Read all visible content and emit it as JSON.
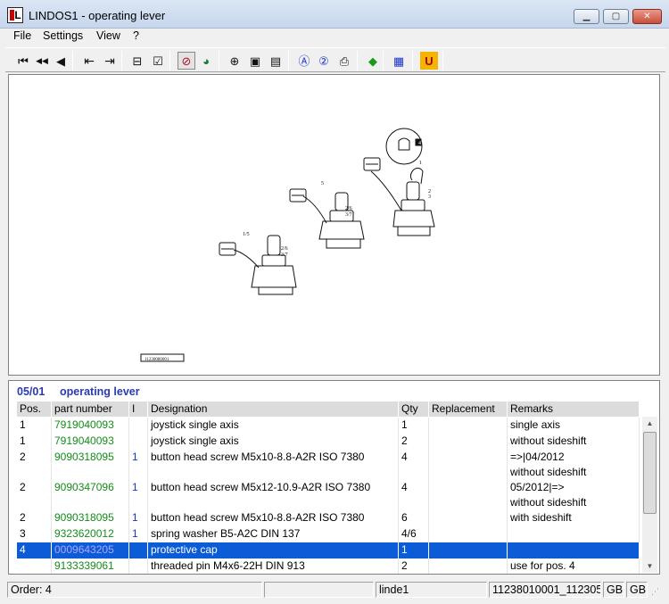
{
  "window": {
    "title": "LINDOS1 - operating lever",
    "app_icon_letter": "L"
  },
  "menu": [
    "File",
    "Settings",
    "View",
    "?"
  ],
  "toolbar": {
    "buttons": [
      {
        "icon": "first-icon",
        "glyph": "⏮"
      },
      {
        "icon": "fast-back-icon",
        "glyph": "◀◀"
      },
      {
        "icon": "back-icon",
        "glyph": "◀"
      },
      {
        "icon": "prev-page-icon",
        "glyph": "⇤"
      },
      {
        "icon": "next-page-icon",
        "glyph": "⇥"
      },
      {
        "icon": "cart-icon",
        "glyph": "⊟"
      },
      {
        "icon": "checklist-icon",
        "glyph": "☑"
      },
      {
        "icon": "hotspot-icon",
        "glyph": "⊘"
      },
      {
        "icon": "globe-icon",
        "glyph": "◕"
      },
      {
        "icon": "zoom-icon",
        "glyph": "⊕"
      },
      {
        "icon": "page-icon",
        "glyph": "▣"
      },
      {
        "icon": "page-alt-icon",
        "glyph": "▤"
      },
      {
        "icon": "search-a-icon",
        "glyph": "Ⓐ"
      },
      {
        "icon": "search-2-icon",
        "glyph": "②"
      },
      {
        "icon": "print-icon",
        "glyph": "⎙"
      },
      {
        "icon": "export-icon",
        "glyph": "◆"
      },
      {
        "icon": "grid-icon",
        "glyph": "▦"
      },
      {
        "icon": "u-icon",
        "glyph": "U"
      }
    ]
  },
  "section": {
    "code": "05/01",
    "name": "operating lever"
  },
  "table": {
    "headers": [
      "Pos.",
      "part number",
      "I",
      "Designation",
      "Qty",
      "Replacement",
      "Remarks"
    ],
    "rows": [
      {
        "pos": "1",
        "part_number": "7919040093",
        "ind": "",
        "designation": "joystick single axis",
        "qty": "1",
        "replacement": "",
        "remarks": "single axis",
        "remarks2": ""
      },
      {
        "pos": "1",
        "part_number": "7919040093",
        "ind": "",
        "designation": "joystick single axis",
        "qty": "2",
        "replacement": "",
        "remarks": "without sideshift",
        "remarks2": ""
      },
      {
        "pos": "2",
        "part_number": "9090318095",
        "ind": "1",
        "designation": "button head screw M5x10-8.8-A2R  ISO 7380",
        "qty": "4",
        "replacement": "",
        "remarks": "=>|04/2012",
        "remarks2": "without sideshift"
      },
      {
        "pos": "2",
        "part_number": "9090347096",
        "ind": "1",
        "designation": "button head screw M5x12-10.9-A2R  ISO 7380",
        "qty": "4",
        "replacement": "",
        "remarks": "05/2012|=>",
        "remarks2": "without sideshift"
      },
      {
        "pos": "2",
        "part_number": "9090318095",
        "ind": "1",
        "designation": "button head screw M5x10-8.8-A2R  ISO 7380",
        "qty": "6",
        "replacement": "",
        "remarks": "with sideshift",
        "remarks2": ""
      },
      {
        "pos": "3",
        "part_number": "9323620012",
        "ind": "1",
        "designation": "spring washer B5-A2C  DIN 137",
        "qty": "4/6",
        "replacement": "",
        "remarks": "",
        "remarks2": ""
      },
      {
        "pos": "4",
        "part_number": "0009643205",
        "ind": "",
        "designation": "protective cap",
        "qty": "1",
        "replacement": "",
        "remarks": "",
        "remarks2": "",
        "selected": true
      },
      {
        "pos": "",
        "part_number": "9133339061",
        "ind": "",
        "designation": "threaded pin M4x6-22H  DIN 913",
        "qty": "2",
        "replacement": "",
        "remarks": "use for pos. 4",
        "remarks2": ""
      }
    ]
  },
  "drawing": {
    "drawing_number": "11230080001",
    "labels": {
      "l1": "1",
      "l4": "4",
      "l5": "5",
      "l15": "1/5",
      "l26a": "2/6",
      "l37a": "3/7",
      "l26b": "2/6",
      "l37b": "3/7",
      "l2": "2",
      "l3": "3"
    }
  },
  "status": {
    "order": "Order: 4",
    "blank": "",
    "user": "linde1",
    "document": "11238010001_112305",
    "lang1": "GB",
    "lang2": "GB"
  }
}
